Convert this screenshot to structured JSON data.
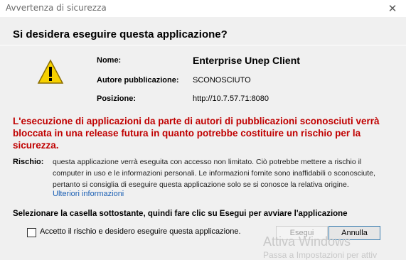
{
  "window": {
    "title": "Avvertenza di sicurezza",
    "close_icon": "close-icon"
  },
  "header": {
    "question": "Si desidera eseguire questa applicazione?"
  },
  "details": {
    "icon": "warning-triangle-icon",
    "name_label": "Nome:",
    "name_value": "Enterprise Unep Client",
    "publisher_label": "Autore pubblicazione:",
    "publisher_value": "SCONOSCIUTO",
    "location_label": "Posizione:",
    "location_value": "http://10.7.57.71:8080"
  },
  "warning": {
    "text": "L'esecuzione di applicazioni da parte di autori di pubblicazioni sconosciuti verrà bloccata in una release futura in quanto potrebbe costituire un rischio per la sicurezza."
  },
  "risk": {
    "label": "Rischio:",
    "text": "questa applicazione verrà eseguita con accesso non limitato. Ciò potrebbe mettere a rischio il computer in uso e le informazioni personali. Le informazioni fornite sono inaffidabili o sconosciute, pertanto si consiglia di eseguire questa applicazione solo se si conosce la relativa origine.",
    "more_info_link": "Ulteriori informazioni"
  },
  "footer": {
    "instruction": "Selezionare la casella sottostante, quindi fare clic su Esegui per avviare l'applicazione",
    "checkbox_label": "Accetto il rischio e desidero eseguire questa applicazione.",
    "checkbox_checked": false,
    "run_button": "Esegui",
    "cancel_button": "Annulla"
  },
  "watermark": {
    "line1": "Attiva Windows",
    "line2": "Passa a Impostazioni per attiv"
  },
  "colors": {
    "warning_red": "#c00000",
    "link_blue": "#1a5fb4",
    "focus_border": "#3c7fb1"
  }
}
